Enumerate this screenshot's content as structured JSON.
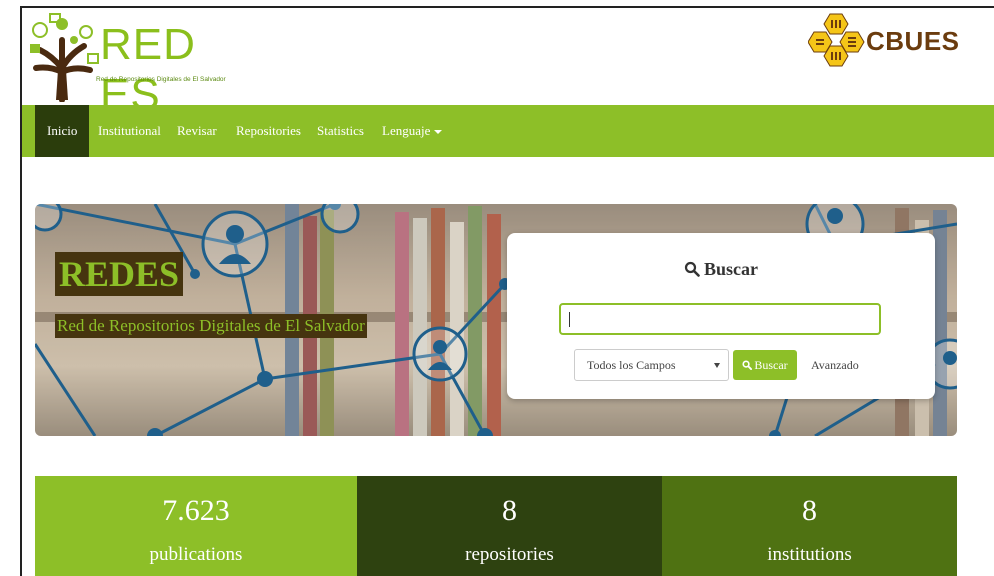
{
  "header": {
    "logo_title": "RED ES",
    "logo_subtitle": "Red de Repositorios Digitales de El Salvador",
    "partner_logo_text": "CBUES"
  },
  "nav": {
    "items": [
      {
        "label": "Inicio",
        "active": true
      },
      {
        "label": "Institutional"
      },
      {
        "label": "Revisar"
      },
      {
        "label": "Repositories"
      },
      {
        "label": "Statistics"
      },
      {
        "label": "Lenguaje",
        "dropdown": true
      }
    ]
  },
  "hero": {
    "title": "REDES",
    "subtitle": "Red de Repositorios Digitales de El Salvador"
  },
  "search": {
    "title": "Buscar",
    "input_value": "",
    "field_selected": "Todos los Campos",
    "button_label": "Buscar",
    "advanced_label": "Avanzado"
  },
  "stats": [
    {
      "value": "7.623",
      "label": "publications",
      "color": "#8dbf28"
    },
    {
      "value": "8",
      "label": "repositories",
      "color": "#2e4210"
    },
    {
      "value": "8",
      "label": "institutions",
      "color": "#4f7212"
    }
  ],
  "colors": {
    "brand_green": "#8dbf28",
    "nav_active": "#2b3d0c",
    "hero_text_bg": "#46340f"
  },
  "icons": {
    "search": "search-icon",
    "dropdown": "caret-down-icon"
  }
}
